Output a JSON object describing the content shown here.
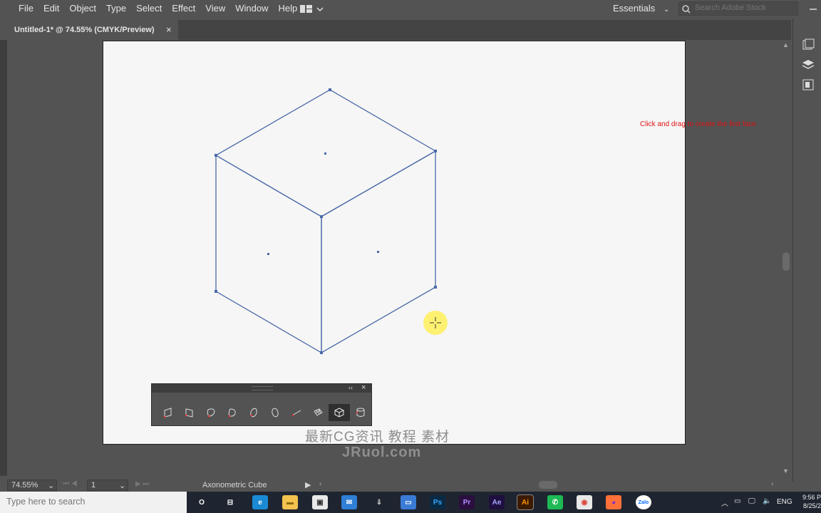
{
  "menu": {
    "items": [
      "File",
      "Edit",
      "Object",
      "Type",
      "Select",
      "Effect",
      "View",
      "Window",
      "Help"
    ],
    "workspace": "Essentials",
    "search_placeholder": "Search Adobe Stock"
  },
  "document": {
    "tab_title": "Untitled-1* @ 74.55% (CMYK/Preview)",
    "tab_close": "×"
  },
  "canvas": {
    "hint_text": "Click and drag to create the first face",
    "watermark_line1": "最新CG资讯 教程 素材",
    "watermark_line2": "JRuol.com"
  },
  "cube_panel": {
    "collapse_glyph": "‹‹",
    "close_glyph": "×",
    "tools": [
      {
        "name": "face-tool-1-icon",
        "active": false
      },
      {
        "name": "face-tool-2-icon",
        "active": false
      },
      {
        "name": "face-tool-3-icon",
        "active": false
      },
      {
        "name": "face-tool-4-icon",
        "active": false
      },
      {
        "name": "circle-tool-1-icon",
        "active": false
      },
      {
        "name": "circle-tool-2-icon",
        "active": false
      },
      {
        "name": "line-tool-icon",
        "active": false
      },
      {
        "name": "grid-tool-icon",
        "active": false
      },
      {
        "name": "axonometric-cube-icon",
        "active": true
      },
      {
        "name": "cylinder-tool-icon",
        "active": false
      }
    ]
  },
  "status": {
    "zoom": "74.55%",
    "page": "1",
    "tool_name": "Axonometric Cube"
  },
  "taskbar": {
    "search_placeholder": "Type here to search",
    "apps": [
      {
        "name": "cortana-icon",
        "label": "O",
        "color": "#1f2530",
        "fg": "#ffffff"
      },
      {
        "name": "task-view-icon",
        "label": "⊟",
        "color": "#1f2530",
        "fg": "#ffffff"
      },
      {
        "name": "edge-icon",
        "label": "e",
        "color": "#1a8ad4",
        "fg": "#ffffff"
      },
      {
        "name": "file-explorer-icon",
        "label": "▬",
        "color": "#f2c14e",
        "fg": "#8a6a12"
      },
      {
        "name": "store-icon",
        "label": "▣",
        "color": "#e8e8e8",
        "fg": "#333333"
      },
      {
        "name": "mail-icon",
        "label": "✉",
        "color": "#2f7fd6",
        "fg": "#ffffff"
      },
      {
        "name": "photos-icon",
        "label": "▭",
        "color": "#3a7bd5",
        "fg": "#ffffff"
      },
      {
        "name": "download-icon",
        "label": "⇓",
        "color": "#1f2530",
        "fg": "#c9c9c9"
      },
      {
        "name": "photoshop-icon",
        "label": "Ps",
        "color": "#0a2a43",
        "fg": "#31a8ff"
      },
      {
        "name": "premiere-icon",
        "label": "Pr",
        "color": "#2a0f3f",
        "fg": "#b48cff"
      },
      {
        "name": "after-effects-icon",
        "label": "Ae",
        "color": "#1f0f3f",
        "fg": "#a6a6ff"
      },
      {
        "name": "illustrator-icon",
        "label": "Ai",
        "color": "#3c1a00",
        "fg": "#ff9a00"
      },
      {
        "name": "phone-app-icon",
        "label": "✆",
        "color": "#1db954",
        "fg": "#ffffff"
      },
      {
        "name": "chrome-icon",
        "label": "◉",
        "color": "#e8e8e8",
        "fg": "#db4437"
      },
      {
        "name": "firefox-icon",
        "label": "◕",
        "color": "#ff7139",
        "fg": "#6a2bd5"
      },
      {
        "name": "zalo-icon",
        "label": "Zalo",
        "color": "#ffffff",
        "fg": "#0068ff"
      }
    ],
    "tray_lang": "ENG",
    "time": "9:56 P",
    "date": "8/25/2"
  },
  "colors": {
    "hint": "#dd1111",
    "cube_stroke": "#4a6aa8",
    "artboard": "#f6f6f6",
    "ui_dark": "#535353"
  }
}
